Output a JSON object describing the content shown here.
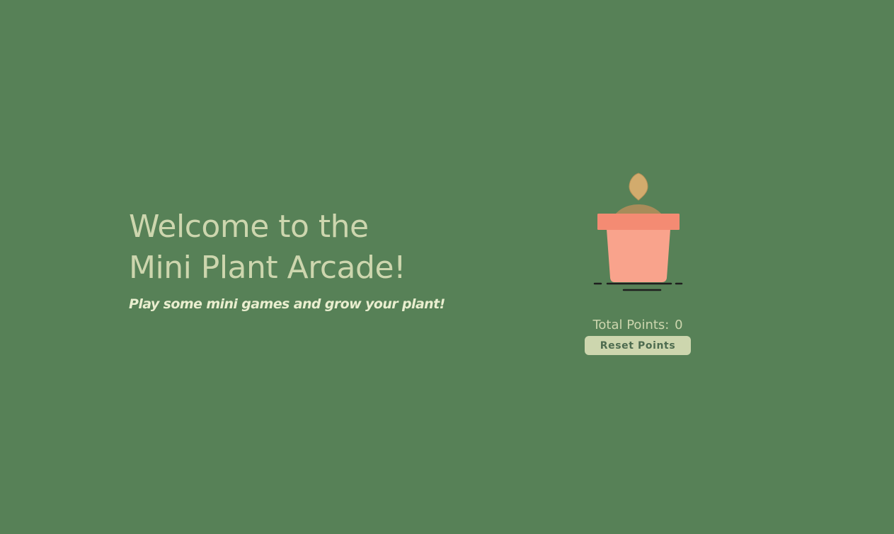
{
  "hero": {
    "title_line1": "Welcome to the",
    "title_line2": "Mini Plant Arcade!",
    "subtitle": "Play some mini games and grow your plant!"
  },
  "plant": {
    "icon": "potted-seedling-icon",
    "stage": "seed"
  },
  "score": {
    "label": "Total Points:",
    "value": "0",
    "reset_label": "Reset Points"
  },
  "colors": {
    "background": "#578157",
    "title": "#cdd6ae",
    "subtitle": "#e9eecf",
    "pot_rim": "#f48b73",
    "pot_body": "#f9a38c",
    "soil": "#a88c5a",
    "seed": "#d2ab6d",
    "button_bg": "#cdd6ae",
    "button_text": "#4d6b4f"
  }
}
